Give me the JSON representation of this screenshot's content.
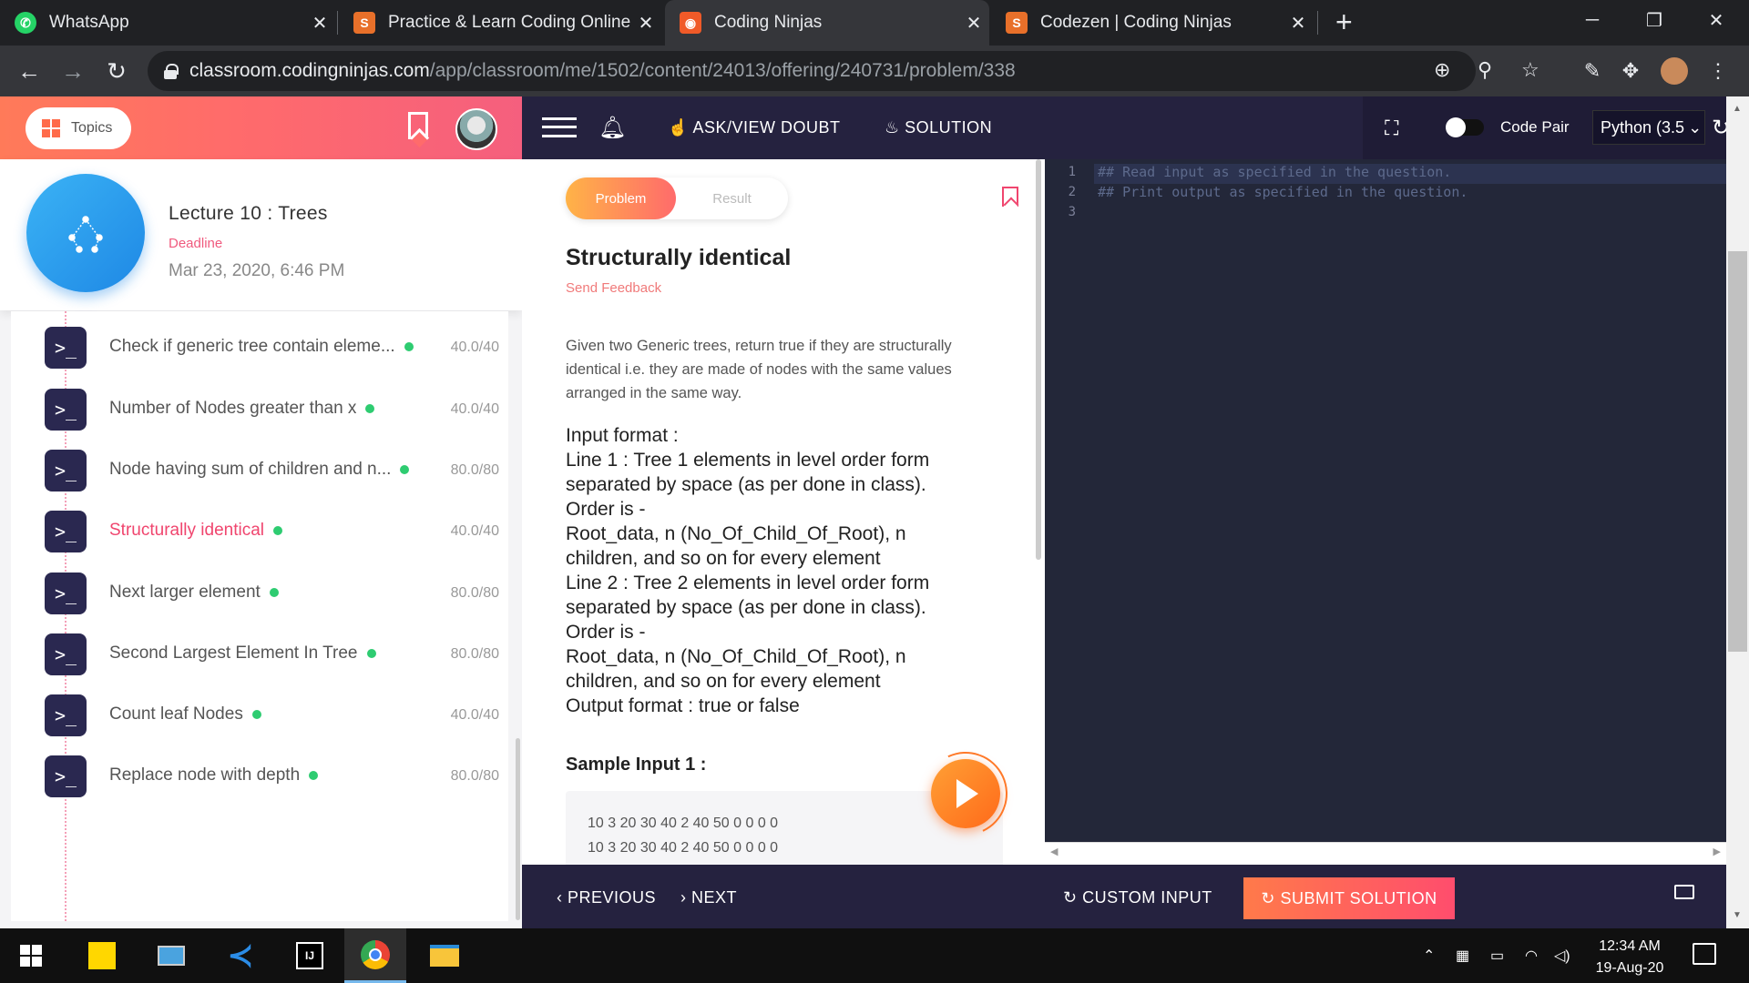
{
  "browser": {
    "tabs": [
      {
        "title": "WhatsApp",
        "active": false,
        "favicon_color": "#25d366"
      },
      {
        "title": "Practice & Learn Coding Online a",
        "active": false,
        "favicon_color": "#e8702a"
      },
      {
        "title": "Coding Ninjas",
        "active": true,
        "favicon_color": "#f05a28"
      },
      {
        "title": "Codezen | Coding Ninjas",
        "active": false,
        "favicon_color": "#e8702a"
      }
    ],
    "url_host": "classroom.codingninjas.com",
    "url_path": "/app/classroom/me/1502/content/24013/offering/240731/problem/338"
  },
  "left_panel": {
    "topics_label": "Topics",
    "lecture_title": "Lecture 10 : Trees",
    "deadline_label": "Deadline",
    "deadline": "Mar 23, 2020, 6:46 PM",
    "items": [
      {
        "name": "Check if generic tree contain eleme...",
        "score": "40.0/40",
        "active": false
      },
      {
        "name": "Number of Nodes greater than x",
        "score": "40.0/40",
        "active": false
      },
      {
        "name": "Node having sum of children and n...",
        "score": "80.0/80",
        "active": false
      },
      {
        "name": "Structurally identical",
        "score": "40.0/40",
        "active": true
      },
      {
        "name": "Next larger element",
        "score": "80.0/80",
        "active": false
      },
      {
        "name": "Second Largest Element In Tree",
        "score": "80.0/80",
        "active": false
      },
      {
        "name": "Count leaf Nodes",
        "score": "40.0/40",
        "active": false
      },
      {
        "name": "Replace node with depth",
        "score": "80.0/80",
        "active": false
      }
    ]
  },
  "topnav": {
    "doubt": "ASK/VIEW DOUBT",
    "solution": "SOLUTION",
    "code_pair": "Code Pair",
    "language": "Python (3.5"
  },
  "problem": {
    "tab_problem": "Problem",
    "tab_result": "Result",
    "title": "Structurally identical",
    "send_feedback": "Send Feedback",
    "description": "Given two Generic trees, return true if they are structurally identical i.e. they are made of nodes with the same values arranged in the same way.",
    "format_lines": [
      "Input format :",
      "Line 1 : Tree 1 elements in level order form",
      "separated by space (as per done in class).",
      "Order is -",
      "Root_data, n (No_Of_Child_Of_Root), n",
      "children, and so on for every element",
      "Line 2 : Tree 2 elements in level order form",
      "separated by space (as per done in class).",
      "Order is -",
      "Root_data, n (No_Of_Child_Of_Root), n",
      "children, and so on for every element",
      "Output format : true or false"
    ],
    "sample_heading": "Sample Input 1 :",
    "sample_lines": [
      "10 3 20 30 40 2 40 50 0 0 0 0",
      "10 3 20 30 40 2 40 50 0 0 0 0"
    ]
  },
  "editor": {
    "lines": [
      {
        "num": "1",
        "text": "## Read input as specified in the question."
      },
      {
        "num": "2",
        "text": "## Print output as specified in the question."
      },
      {
        "num": "3",
        "text": ""
      }
    ]
  },
  "bottombar": {
    "previous": "PREVIOUS",
    "next": "NEXT",
    "custom_input": "CUSTOM INPUT",
    "submit": "SUBMIT SOLUTION"
  },
  "taskbar": {
    "time": "12:34 AM",
    "date": "19-Aug-20"
  },
  "colors": {
    "accent_pink": "#f0456e",
    "dark_nav": "#25223f",
    "editor_bg": "#232739",
    "status_green": "#2ecc71"
  }
}
